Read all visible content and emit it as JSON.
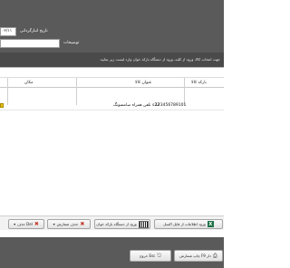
{
  "header": {
    "date_label": "تاریخ انبارگردانی",
    "date_value": "۰۲/۱۱",
    "description_label": "توضیحات"
  },
  "info_text": "جهت انتخاب کالا، ورود از کلید، ورود از دستگاه بارکد خوان وارد لیست زیر نمایید",
  "table": {
    "columns": [
      "بارکد کالا",
      "عنوان کالا",
      "مکان"
    ],
    "rows": [
      {
        "barcode": "123456789101",
        "title": "s22 تلفن همراه سامسونگ",
        "location": ""
      }
    ]
  },
  "buttons": {
    "delete": "حذف Del",
    "remove_inventory": "حذف شمارش",
    "barcode_import": "ورود از دستگاه بارکد خوان",
    "excel_import": "ورود اطلاعات از فایل اکسل",
    "print": "چاپ شمارش F9 دار",
    "exit": "خروج Esc"
  },
  "colors": {
    "panel": "#5a5a5a",
    "excel": "#1e7145",
    "delete": "#c0392b",
    "marker": "#e8c200"
  }
}
